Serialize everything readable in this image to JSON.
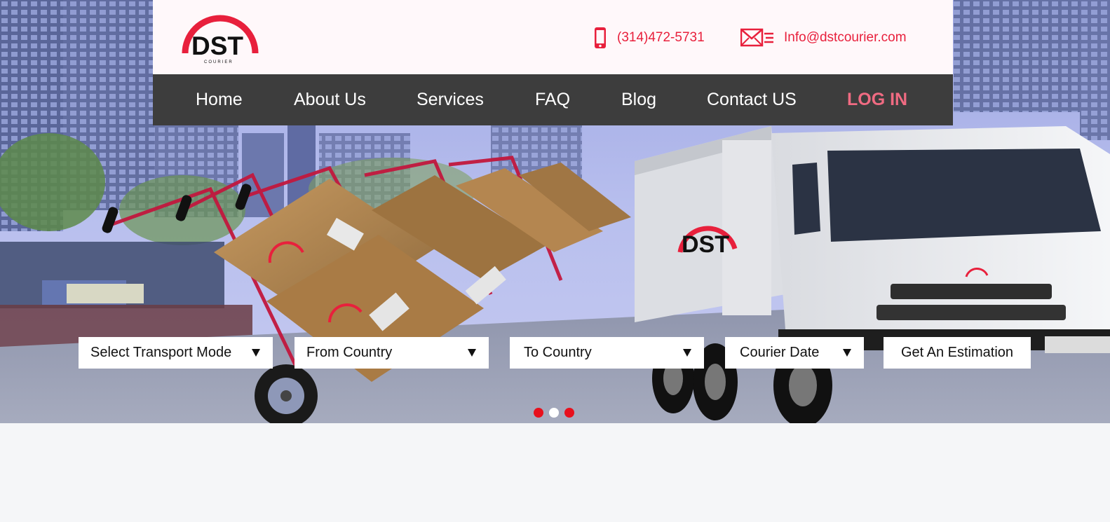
{
  "brand": {
    "logo_text": "DST",
    "logo_subtext": "COURIER",
    "accent_color": "#e8203c"
  },
  "header": {
    "phone": "(314)472-5731",
    "email": "Info@dstcourier.com",
    "phone_icon": "mobile-phone-icon",
    "email_icon": "envelope-icon"
  },
  "nav": {
    "items": [
      {
        "label": "Home"
      },
      {
        "label": "About Us"
      },
      {
        "label": "Services"
      },
      {
        "label": "FAQ"
      },
      {
        "label": "Blog"
      },
      {
        "label": "Contact US"
      }
    ],
    "login_label": "LOG IN",
    "login_color": "#f06b82"
  },
  "search": {
    "transport_mode": "Select Transport Mode",
    "from_country": "From Country",
    "to_country": "To Country",
    "courier_date": "Courier Date",
    "estimate_button": "Get An Estimation"
  },
  "slider": {
    "slide_count": 3,
    "active_index": 1,
    "active_color": "#ffffff",
    "inactive_color": "#e8101c"
  }
}
